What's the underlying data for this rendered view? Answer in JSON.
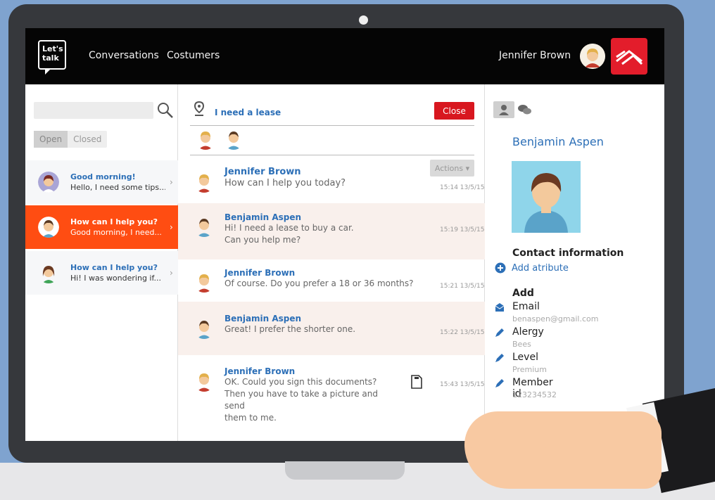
{
  "app": {
    "logo_text_1": "Let's",
    "logo_text_2": "talk",
    "nav": [
      "Conversations",
      "Costumers"
    ],
    "user_name": "Jennifer Brown"
  },
  "sidebar": {
    "search_placeholder": "",
    "tabs": [
      {
        "label": "Open"
      },
      {
        "label": "Closed"
      }
    ],
    "conversations": [
      {
        "title": "Good morning!",
        "preview": "Hello, I need some tips..."
      },
      {
        "title": "How can I help you?",
        "preview": "Good morning, I need..."
      },
      {
        "title": "How can I help you?",
        "preview": "Hi! I was wondering if..."
      }
    ]
  },
  "chat": {
    "topic": "I need a lease",
    "close_label": "Close",
    "actions_label": "Actions ▾",
    "messages": [
      {
        "sender": "Jennifer Brown",
        "lines": [
          "How can I help you today?"
        ],
        "time": "15:14 13/5/15"
      },
      {
        "sender": "Benjamin Aspen",
        "lines": [
          "Hi! I need a lease to buy a car.",
          "Can you help me?"
        ],
        "time": "15:19 13/5/15"
      },
      {
        "sender": "Jennifer Brown",
        "lines": [
          "Of course. Do you prefer a 18 or 36 months?"
        ],
        "time": "15:21 13/5/15"
      },
      {
        "sender": "Benjamin Aspen",
        "lines": [
          "Great! I prefer the shorter one."
        ],
        "time": "15:22 13/5/15"
      },
      {
        "sender": "Jennifer Brown",
        "lines": [
          "OK. Could you sign this documents?",
          "Then you have to take a picture and send",
          "them to me."
        ],
        "time": "15:43 13/5/15"
      }
    ]
  },
  "contact": {
    "name": "Benjamin Aspen",
    "contact_info_title": "Contact information",
    "add_attribute_label": "Add atribute",
    "add_title": "Add",
    "fields": [
      {
        "label": "Email",
        "value": "benaspen@gmail.com",
        "icon": "email-icon"
      },
      {
        "label": "Alergy",
        "value": "Bees",
        "icon": "pencil-icon"
      },
      {
        "label": "Level",
        "value": "Premium",
        "icon": "pencil-icon"
      },
      {
        "label": "Member id",
        "value": "123234532",
        "icon": "pencil-icon"
      }
    ]
  },
  "colors": {
    "accent_blue": "#2c6fb7",
    "selected_orange": "#ff4d12",
    "close_red": "#d8171f",
    "bank_red": "#e31d2b"
  }
}
